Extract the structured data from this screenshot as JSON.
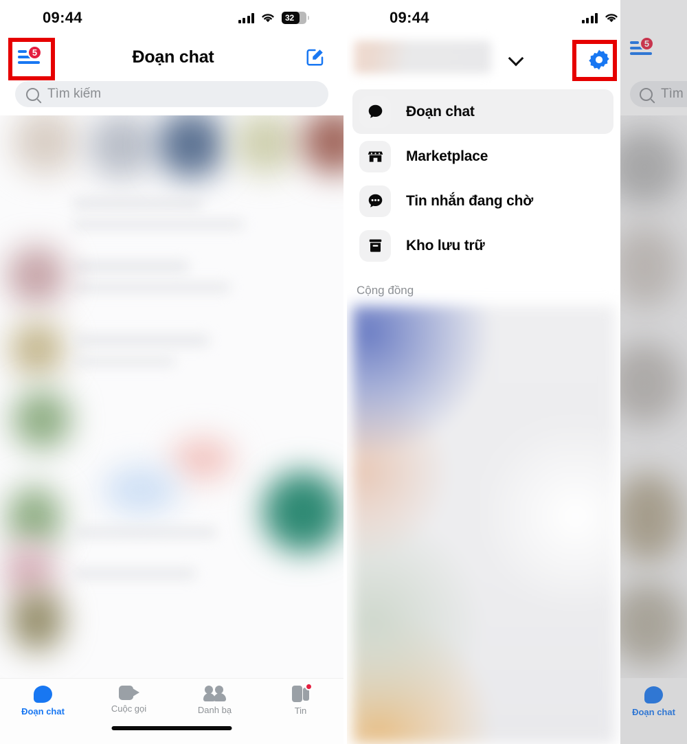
{
  "status_bar": {
    "time": "09:44",
    "battery_level": "32",
    "signal_icon": "cellular-signal-icon",
    "wifi_icon": "wifi-icon",
    "battery_icon": "battery-icon"
  },
  "left_panel": {
    "title": "Đoạn chat",
    "menu_button_icon": "hamburger-menu-icon",
    "menu_badge": "5",
    "compose_icon": "compose-new-message-icon",
    "search": {
      "placeholder": "Tìm kiếm",
      "icon": "search-icon"
    },
    "tabs": [
      {
        "label": "Đoạn chat",
        "icon": "chat-bubble-icon",
        "active": true,
        "badge": ""
      },
      {
        "label": "Cuộc gọi",
        "icon": "video-camera-icon",
        "active": false,
        "badge": ""
      },
      {
        "label": "Danh bạ",
        "icon": "people-icon",
        "active": false,
        "badge": ""
      },
      {
        "label": "Tin",
        "icon": "stories-icon",
        "active": false,
        "badge": "dot"
      }
    ]
  },
  "drawer_panel": {
    "profile_name_blurred": "",
    "chevron_icon": "chevron-down-icon",
    "settings_icon": "gear-settings-icon",
    "menu_items": [
      {
        "label": "Đoạn chat",
        "icon": "chat-bubble-filled-icon",
        "selected": true
      },
      {
        "label": "Marketplace",
        "icon": "storefront-icon",
        "selected": false
      },
      {
        "label": "Tin nhắn đang chờ",
        "icon": "chat-bubble-dots-icon",
        "selected": false
      },
      {
        "label": "Kho lưu trữ",
        "icon": "archive-box-icon",
        "selected": false
      }
    ],
    "section_title": "Cộng đồng"
  },
  "peek_panel": {
    "menu_button_icon": "hamburger-menu-icon",
    "menu_badge": "5",
    "search_placeholder": "Tìm",
    "search_icon": "search-icon",
    "tab_label": "Đoạn chat",
    "tab_icon": "chat-bubble-icon"
  },
  "highlights": [
    {
      "target": "left-panel-menu-button",
      "color": "#e60000"
    },
    {
      "target": "drawer-settings-button",
      "color": "#e60000"
    }
  ],
  "colors": {
    "accent_blue": "#1877f2",
    "badge_red": "#e41e3f",
    "highlight_red": "#e60000",
    "muted_grey": "#8a8d91",
    "surface_grey": "#eceef1"
  }
}
